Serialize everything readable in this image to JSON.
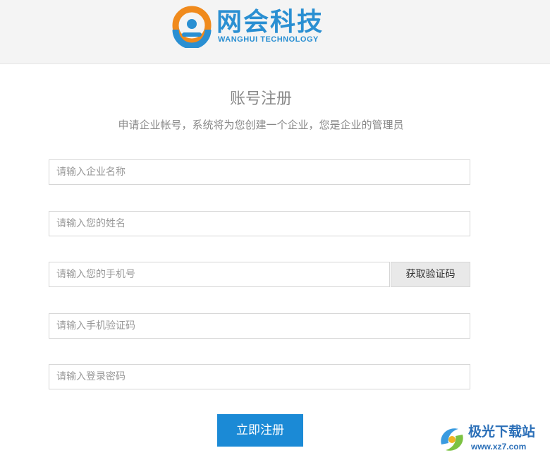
{
  "header": {
    "logo_cn": "网会科技",
    "logo_en": "WANGHUI TECHNOLOGY"
  },
  "form": {
    "title": "账号注册",
    "subtitle": "申请企业帐号，系统将为您创建一个企业，您是企业的管理员",
    "company_placeholder": "请输入企业名称",
    "name_placeholder": "请输入您的姓名",
    "phone_placeholder": "请输入您的手机号",
    "get_code_label": "获取验证码",
    "code_placeholder": "请输入手机验证码",
    "password_placeholder": "请输入登录密码",
    "submit_label": "立即注册"
  },
  "watermark": {
    "site_name": "极光下载站",
    "url": "www.xz7.com"
  },
  "colors": {
    "accent": "#1b8ad6",
    "logo_blue": "#2a8fd2",
    "logo_orange": "#f08a1c",
    "header_bg": "#f4f4f4"
  },
  "icons": {
    "logo": "wanghui-logo-icon",
    "watermark": "xz7-swirl-icon"
  }
}
